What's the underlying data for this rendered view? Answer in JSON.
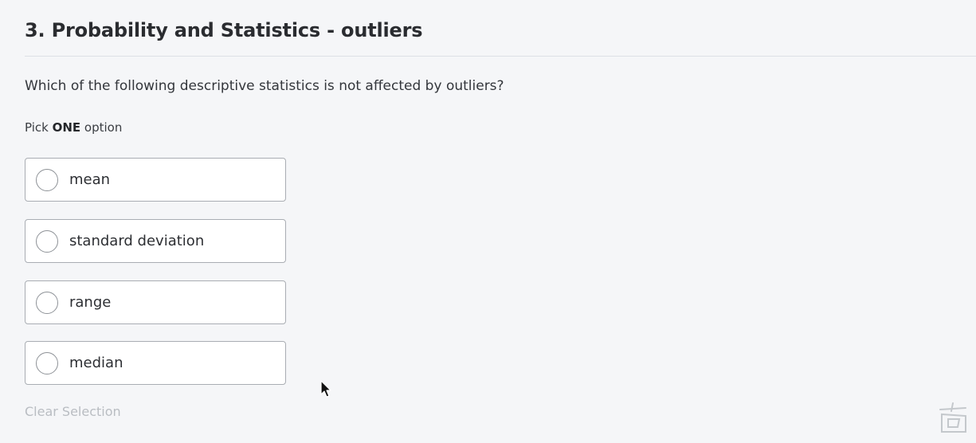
{
  "question": {
    "title": "3. Probability and Statistics - outliers",
    "text": "Which of the following descriptive statistics is not affected by outliers?",
    "instruction_prefix": "Pick ",
    "instruction_emphasis": "ONE",
    "instruction_suffix": " option"
  },
  "options": [
    {
      "label": "mean",
      "selected": false
    },
    {
      "label": "standard deviation",
      "selected": false
    },
    {
      "label": "range",
      "selected": false
    },
    {
      "label": "median",
      "selected": false
    }
  ],
  "clear_selection_label": "Clear Selection",
  "icons": {
    "radio": "radio-unchecked-icon",
    "cursor": "mouse-pointer-icon",
    "watermark": "watermark-logo"
  },
  "colors": {
    "background": "#f5f6f8",
    "option_border": "#a9adb3",
    "clear_selection_disabled": "#b9bdc2"
  }
}
